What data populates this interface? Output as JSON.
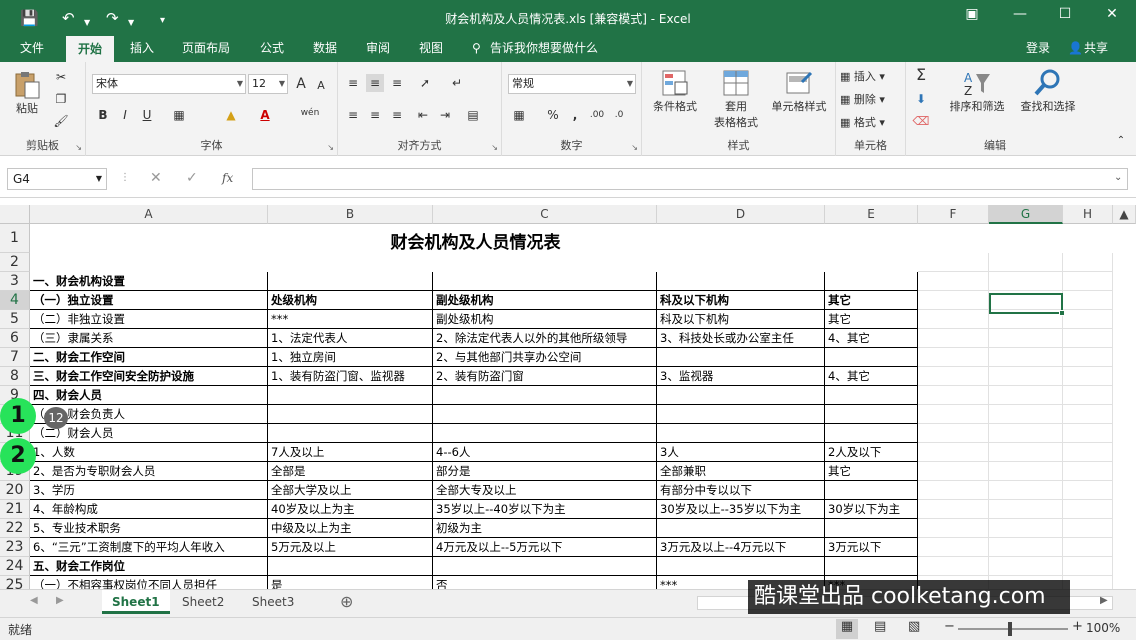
{
  "window": {
    "title": "财会机构及人员情况表.xls  [兼容模式] - Excel"
  },
  "menu": {
    "tabs": [
      "文件",
      "开始",
      "插入",
      "页面布局",
      "公式",
      "数据",
      "审阅",
      "视图"
    ],
    "active_tab": "开始",
    "tell_me": "告诉我你想要做什么",
    "login": "登录",
    "share": "共享"
  },
  "ribbon": {
    "clipboard": {
      "label": "剪贴板",
      "paste": "粘贴"
    },
    "font": {
      "label": "字体",
      "name": "宋体",
      "size": "12",
      "bold": "B",
      "italic": "I",
      "underline": "U",
      "grow": "A",
      "shrink": "A",
      "font_color": "A",
      "wen": "wén"
    },
    "alignment": {
      "label": "对齐方式"
    },
    "number": {
      "label": "数字",
      "format": "常规",
      "percent": "%"
    },
    "styles": {
      "label": "样式",
      "conditional": "条件格式",
      "table1": "套用",
      "table2": "表格格式",
      "cell_styles": "单元格样式"
    },
    "cells": {
      "label": "单元格",
      "insert": "插入",
      "delete": "删除",
      "format": "格式"
    },
    "editing": {
      "label": "编辑",
      "sort_filter": "排序和筛选",
      "find_select": "查找和选择"
    }
  },
  "formula_bar": {
    "name_box": "G4",
    "fx": "fx",
    "value": ""
  },
  "columns": [
    "A",
    "B",
    "C",
    "D",
    "E",
    "F",
    "G",
    "H"
  ],
  "selected_column": "G",
  "selected_row": "4",
  "row_headers": [
    "1",
    "2",
    "3",
    "4",
    "5",
    "6",
    "7",
    "8",
    "9",
    "10",
    "11",
    "12",
    "19",
    "20",
    "21",
    "22",
    "23",
    "24",
    "25"
  ],
  "sheet_title": "财会机构及人员情况表",
  "table_rows": [
    {
      "a": "一、财会机构设置",
      "b": "",
      "c": "",
      "d": "",
      "e": "",
      "bold": true
    },
    {
      "a": "（一）独立设置",
      "b": "处级机构",
      "c": "副处级机构",
      "d": "科及以下机构",
      "e": "其它",
      "bold_row": true
    },
    {
      "a": "（二）非独立设置",
      "b": "***",
      "c": "副处级机构",
      "d": "科及以下机构",
      "e": "其它"
    },
    {
      "a": "（三）隶属关系",
      "b": "1、法定代表人",
      "c": "2、除法定代表人以外的其他所级领导",
      "d": "3、科技处长或办公室主任",
      "e": "4、其它"
    },
    {
      "a": "二、财会工作空间",
      "b": "1、独立房间",
      "c": "2、与其他部门共享办公空间",
      "d": "",
      "e": "",
      "bold": true
    },
    {
      "a": "三、财会工作空间安全防护设施",
      "b": "1、装有防盗门窗、监视器",
      "c": "2、装有防盗门窗",
      "d": "3、监视器",
      "e": "4、其它",
      "bold": true
    },
    {
      "a": "四、财会人员",
      "b": "",
      "c": "",
      "d": "",
      "e": "",
      "bold": true
    },
    {
      "a": "（一）财会负责人",
      "b": "",
      "c": "",
      "d": "",
      "e": ""
    },
    {
      "a": "（二）财会人员",
      "b": "",
      "c": "",
      "d": "",
      "e": ""
    },
    {
      "a": "1、人数",
      "b": "7人及以上",
      "c": "4--6人",
      "d": "3人",
      "e": "2人及以下"
    },
    {
      "a": "2、是否为专职财会人员",
      "b": "全部是",
      "c": "部分是",
      "d": "全部兼职",
      "e": "其它"
    },
    {
      "a": "3、学历",
      "b": "全部大学及以上",
      "c": "全部大专及以上",
      "d": "有部分中专以以下",
      "e": ""
    },
    {
      "a": "4、年龄构成",
      "b": "40岁及以上为主",
      "c": "35岁以上--40岁以下为主",
      "d": "30岁及以上--35岁以下为主",
      "e": "30岁以下为主"
    },
    {
      "a": "5、专业技术职务",
      "b": "中级及以上为主",
      "c": "初级为主",
      "d": "",
      "e": ""
    },
    {
      "a": "6、“三元”工资制度下的平均人年收入",
      "b": "5万元及以上",
      "c": "4万元及以上--5万元以下",
      "d": "3万元及以上--4万元以下",
      "e": "3万元以下"
    },
    {
      "a": "五、财会工作岗位",
      "b": "",
      "c": "",
      "d": "",
      "e": "",
      "bold": true
    },
    {
      "a": "（一）不相容事权岗位不同人员担任",
      "b": "是",
      "c": "否",
      "d": "***",
      "e": "***"
    }
  ],
  "overlays": {
    "marker1": "1",
    "marker2": "2",
    "badge": "12"
  },
  "sheets": [
    "Sheet1",
    "Sheet2",
    "Sheet3"
  ],
  "active_sheet": "Sheet1",
  "status": {
    "ready": "就绪",
    "zoom": "100%"
  },
  "watermark": "酷课堂出品 coolketang.com",
  "colors": {
    "accent": "#217346",
    "marker": "#27e35a"
  }
}
